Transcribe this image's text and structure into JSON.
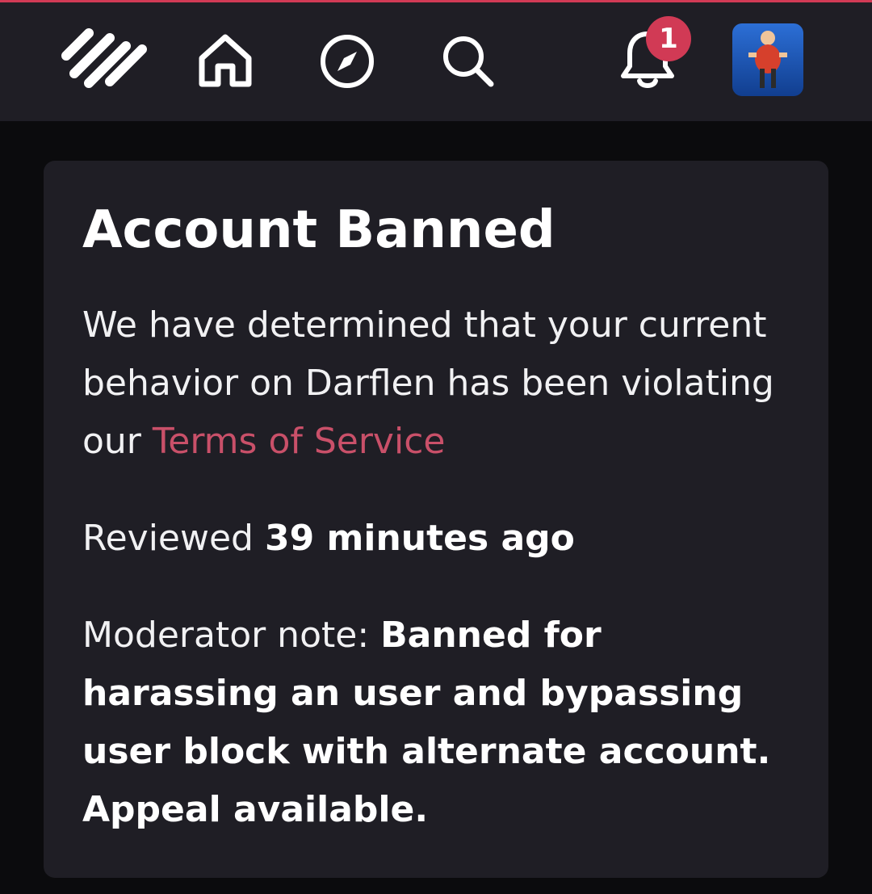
{
  "colors": {
    "accent": "#d13a55",
    "link": "#c95069",
    "navbar_bg": "#1f1e25",
    "card_bg": "#1f1e25",
    "page_bg": "#0b0b0d"
  },
  "navbar": {
    "icons": [
      "logo-icon",
      "home-icon",
      "compass-icon",
      "search-icon",
      "bell-icon"
    ],
    "notification_count": "1"
  },
  "ban_card": {
    "title": "Account Banned",
    "message_prefix": "We have determined that your current behavior on Darflen has been violating our ",
    "terms_link": "Terms of Service",
    "reviewed_label": "Reviewed ",
    "reviewed_time": "39 minutes ago",
    "moderator_label": "Moderator note: ",
    "moderator_note": "Banned for harassing an user and bypassing user block with alternate account. Appeal available."
  }
}
